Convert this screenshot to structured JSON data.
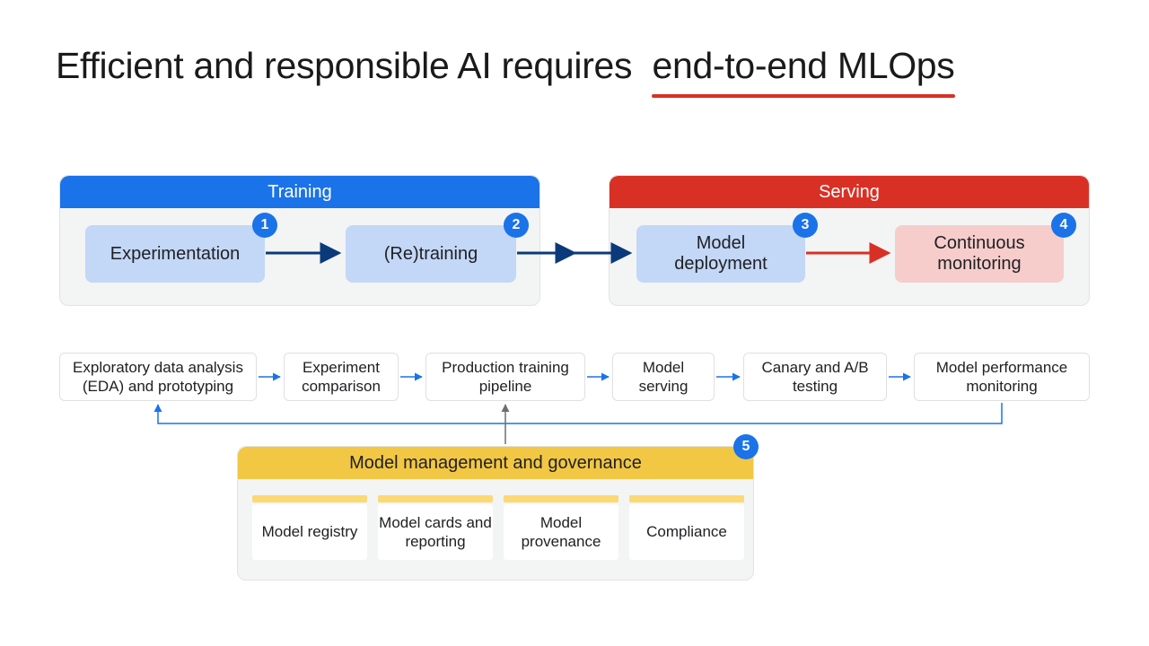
{
  "title": {
    "prefix": "Efficient and responsible AI requires ",
    "highlight": "end-to-end MLOps"
  },
  "panels": {
    "training": {
      "header": "Training"
    },
    "serving": {
      "header": "Serving"
    },
    "governance": {
      "header": "Model management and governance"
    }
  },
  "stages": {
    "s1": {
      "label": "Experimentation",
      "badge": "1"
    },
    "s2": {
      "label": "(Re)training",
      "badge": "2"
    },
    "s3": {
      "label": "Model\ndeployment",
      "badge": "3"
    },
    "s4": {
      "label": "Continuous\nmonitoring",
      "badge": "4"
    }
  },
  "flow": {
    "f1": "Exploratory data analysis (EDA) and prototyping",
    "f2": "Experiment comparison",
    "f3": "Production training pipeline",
    "f4": "Model serving",
    "f5": "Canary and A/B testing",
    "f6": "Model performance monitoring"
  },
  "governance_items": {
    "g1": "Model registry",
    "g2": "Model cards and reporting",
    "g3": "Model provenance",
    "g4": "Compliance"
  },
  "governance_badge": "5"
}
